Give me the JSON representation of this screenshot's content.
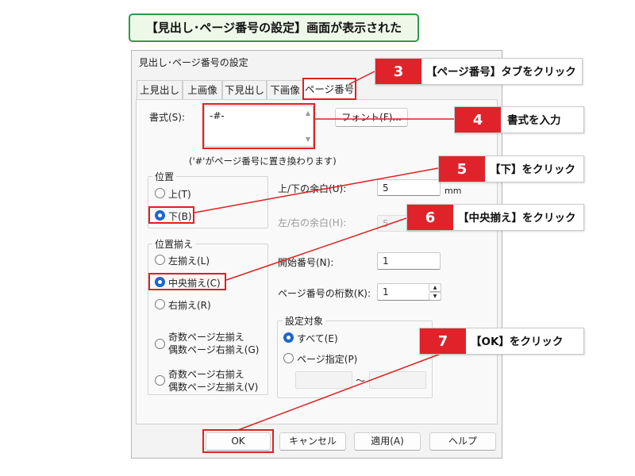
{
  "caption": "【見出し･ページ番号の設定】画面が表示された",
  "dialog": {
    "title": "見出し･ページ番号の設定",
    "tabs": [
      "上見出し",
      "上画像",
      "下見出し",
      "下画像",
      "ページ番号"
    ],
    "format": {
      "label": "書式(S):",
      "value": "-#-",
      "font_button": "フォント(F)...",
      "note": "('#'がページ番号に置き換わります)"
    },
    "position": {
      "title": "位置",
      "options": [
        "上(T)",
        "下(B)"
      ],
      "selected": "下(B)"
    },
    "alignment": {
      "title": "位置揃え",
      "options": [
        "左揃え(L)",
        "中央揃え(C)",
        "右揃え(R)",
        "奇数ページ左揃え",
        "偶数ページ右揃え(G)",
        "奇数ページ右揃え",
        "偶数ページ左揃え(V)"
      ],
      "selected": "中央揃え(C)"
    },
    "margin_tb": {
      "label": "上/下の余白(U):",
      "value": "5",
      "unit": "mm"
    },
    "margin_lr": {
      "label": "左/右の余白(H):",
      "value": "5"
    },
    "start_number": {
      "label": "開始番号(N):",
      "value": "1"
    },
    "digits": {
      "label": "ページ番号の桁数(K):",
      "value": "1"
    },
    "target": {
      "title": "設定対象",
      "options": [
        "すべて(E)",
        "ページ指定(P)"
      ],
      "selected": "すべて(E)",
      "tilde": "～"
    },
    "buttons": {
      "ok": "OK",
      "cancel": "キャンセル",
      "apply": "適用(A)",
      "help": "ヘルプ"
    }
  },
  "callouts": [
    {
      "num": "3",
      "text": "【ページ番号】タブをクリック"
    },
    {
      "num": "4",
      "text": "書式を入力"
    },
    {
      "num": "5",
      "text": "【下】をクリック"
    },
    {
      "num": "6",
      "text": "【中央揃え】をクリック"
    },
    {
      "num": "7",
      "text": "【OK】をクリック"
    }
  ],
  "colors": {
    "accent_red": "#e0232b",
    "caption_border": "#2f9a4a",
    "radio_blue": "#1b66c9"
  }
}
